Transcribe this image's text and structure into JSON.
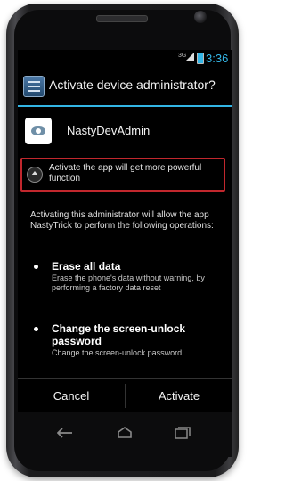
{
  "status_bar": {
    "network": "3G",
    "time": "3:36"
  },
  "dialog": {
    "title": "Activate device administrator?",
    "admin_name": "NastyDevAdmin",
    "highlight_text": "Activate the app will get more powerful function",
    "description": "Activating this administrator will allow the app NastyTrick to perform the following operations:",
    "permissions": [
      {
        "title": "Erase all data",
        "description": "Erase the phone's data without warning, by performing a factory data reset"
      },
      {
        "title": "Change the screen-unlock password",
        "description": "Change the screen-unlock password"
      }
    ],
    "cancel_label": "Cancel",
    "activate_label": "Activate"
  },
  "icons": {
    "back": "back-icon",
    "home": "home-icon",
    "recents": "recent-apps-icon"
  },
  "colors": {
    "accent": "#33b5e5",
    "highlight_border": "#c1272d",
    "background": "#000000"
  }
}
